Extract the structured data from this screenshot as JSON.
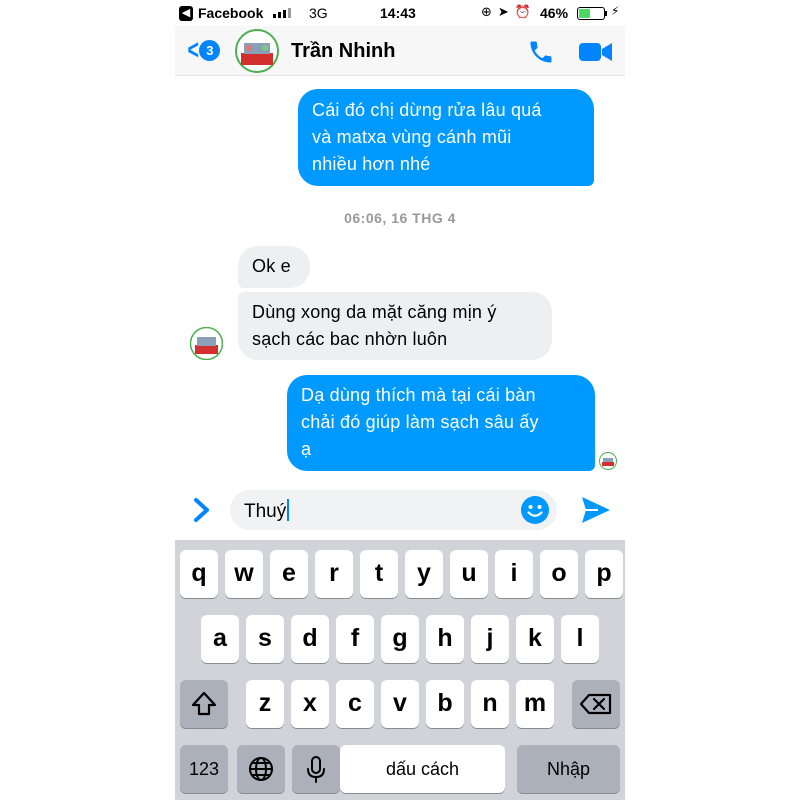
{
  "status_bar": {
    "back_app": "Facebook",
    "network": "3G",
    "time": "14:43",
    "battery_percent": "46%",
    "battery_level": 0.46
  },
  "header": {
    "back_badge_count": "3",
    "contact_name": "Trần Nhinh",
    "accent_color": "#0084ff"
  },
  "messages": [
    {
      "direction": "outgoing",
      "text": "Cái đó chị dừng rửa lâu quá\nvà matxa vùng cánh mũi\nnhiều hơn nhé"
    },
    {
      "direction": "incoming",
      "text": "Ok e"
    },
    {
      "direction": "incoming",
      "text": "Dùng xong da mặt căng mịn ý\nsạch các bac nhờn luôn"
    },
    {
      "direction": "outgoing",
      "text": "Dạ dùng thích mà tại  cái bàn\nchải đó giúp làm sạch sâu ấy\nạ"
    }
  ],
  "timestamp": "06:06, 16 THG 4",
  "composer": {
    "input_value": "Thuý"
  },
  "keyboard": {
    "row1": [
      "q",
      "w",
      "e",
      "r",
      "t",
      "y",
      "u",
      "i",
      "o",
      "p"
    ],
    "row2": [
      "a",
      "s",
      "d",
      "f",
      "g",
      "h",
      "j",
      "k",
      "l"
    ],
    "row3": [
      "z",
      "x",
      "c",
      "v",
      "b",
      "n",
      "m"
    ],
    "numbers_key": "123",
    "space_key": "dấu cách",
    "return_key": "Nhập"
  },
  "colors": {
    "outgoing_bubble": "#0099ff",
    "incoming_bubble": "#eeeff1",
    "keyboard_bg": "#d1d3d9"
  }
}
